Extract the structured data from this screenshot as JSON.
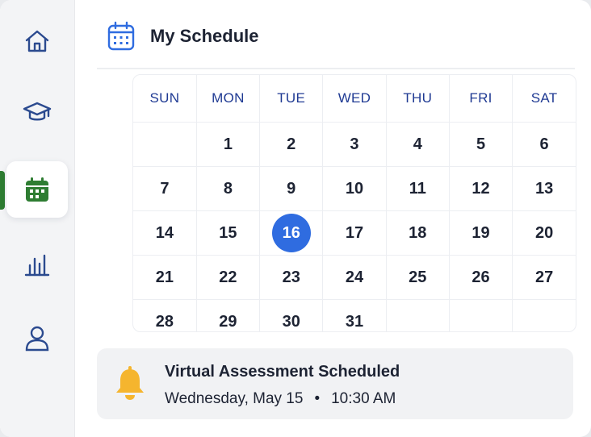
{
  "header": {
    "title": "My Schedule",
    "icon": "calendar-icon"
  },
  "sidebar": {
    "items": [
      {
        "name": "home",
        "icon": "home-icon",
        "active": false
      },
      {
        "name": "courses",
        "icon": "graduation-cap-icon",
        "active": false
      },
      {
        "name": "schedule",
        "icon": "calendar-icon",
        "active": true
      },
      {
        "name": "analytics",
        "icon": "bar-chart-icon",
        "active": false
      },
      {
        "name": "profile",
        "icon": "user-icon",
        "active": false
      }
    ]
  },
  "calendar": {
    "weekdays": [
      "SUN",
      "MON",
      "TUE",
      "WED",
      "THU",
      "FRI",
      "SAT"
    ],
    "weeks": [
      [
        "",
        "1",
        "2",
        "3",
        "4",
        "5",
        "6"
      ],
      [
        "7",
        "8",
        "9",
        "10",
        "11",
        "12",
        "13"
      ],
      [
        "14",
        "15",
        "16",
        "17",
        "18",
        "19",
        "20"
      ],
      [
        "21",
        "22",
        "23",
        "24",
        "25",
        "26",
        "27"
      ],
      [
        "28",
        "29",
        "30",
        "31",
        "",
        "",
        ""
      ]
    ],
    "selected_day": "16"
  },
  "notification": {
    "icon": "bell-icon",
    "title": "Virtual Assessment Scheduled",
    "date": "Wednesday, May 15",
    "separator": "•",
    "time": "10:30 AM"
  },
  "colors": {
    "accent": "#2f6ce0",
    "active_nav": "#2e7d32",
    "nav_icon": "#2b4a8f",
    "bell": "#f5b52e",
    "text": "#1d2333"
  }
}
